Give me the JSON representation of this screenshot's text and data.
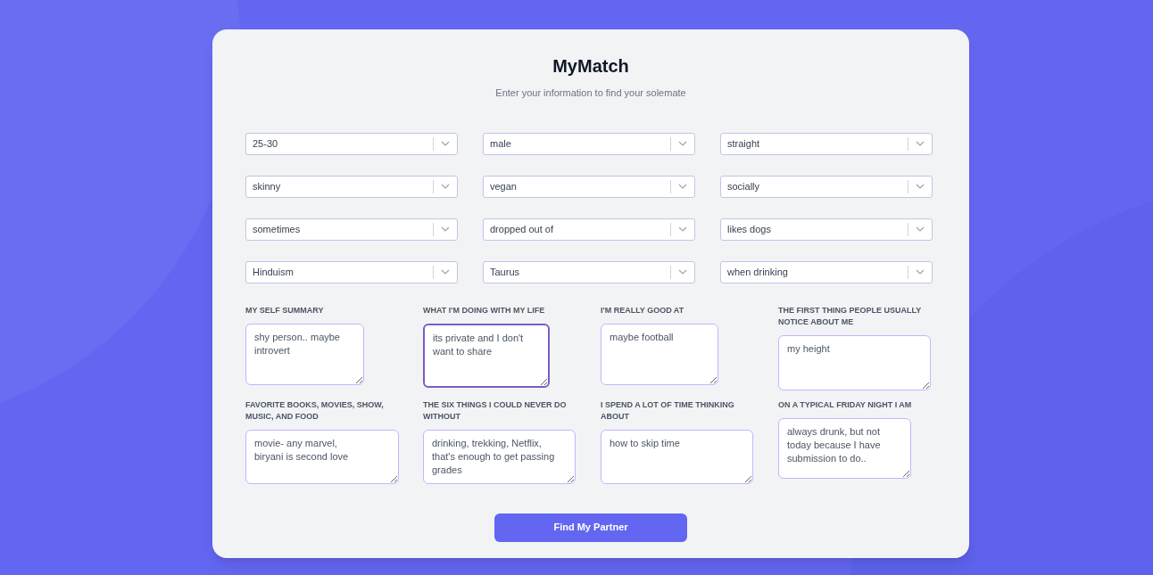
{
  "title": "MyMatch",
  "subtitle": "Enter your information to find your solemate",
  "selects": [
    {
      "value": "25-30"
    },
    {
      "value": "male"
    },
    {
      "value": "straight"
    },
    {
      "value": "skinny"
    },
    {
      "value": "vegan"
    },
    {
      "value": "socially"
    },
    {
      "value": "sometimes"
    },
    {
      "value": "dropped out of"
    },
    {
      "value": "likes dogs"
    },
    {
      "value": "Hinduism"
    },
    {
      "value": "Taurus"
    },
    {
      "value": "when drinking"
    }
  ],
  "questions": [
    {
      "label": "MY SELF SUMMARY",
      "value": "shy person.. maybe introvert",
      "focused": false
    },
    {
      "label": "WHAT I'M DOING WITH MY LIFE",
      "value": "its private and I don't want to share",
      "focused": true
    },
    {
      "label": "I'M REALLY GOOD AT",
      "value": "maybe football",
      "focused": false
    },
    {
      "label": "THE FIRST THING PEOPLE USUALLY NOTICE ABOUT ME",
      "value": "my height",
      "focused": false
    },
    {
      "label": "FAVORITE BOOKS, MOVIES, SHOW, MUSIC, AND FOOD",
      "value": "movie- any marvel,\nbiryani is second love",
      "focused": false
    },
    {
      "label": "THE SIX THINGS I COULD NEVER DO WITHOUT",
      "value": "drinking, trekking, Netflix, that's enough to get passing grades",
      "focused": false
    },
    {
      "label": "I SPEND A LOT OF TIME THINKING ABOUT",
      "value": "how to skip time",
      "focused": false
    },
    {
      "label": "ON A TYPICAL FRIDAY NIGHT I AM",
      "value": "always drunk, but not today because I have submission to do..",
      "focused": false
    }
  ],
  "button": "Find My Partner"
}
